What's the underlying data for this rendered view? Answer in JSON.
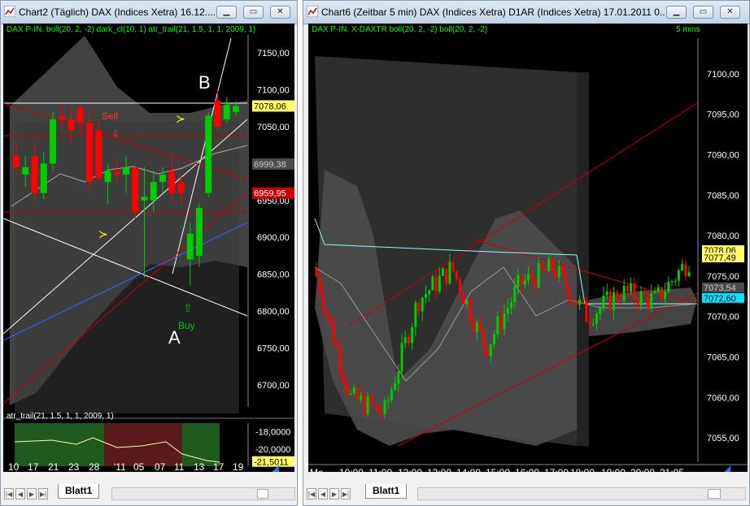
{
  "left": {
    "title": "Chart2 (Täglich)  DAX (Indices Xetra) 16.12....",
    "indicator_header": "DAX P-IN. boll(20, 2, -2) dark_cl(10, 1) atr_trail(21, 1.5, 1, 1, 2009, 1)",
    "sub_header": "atr_trail(21, 1.5, 1, 1, 2009, 1)",
    "sheet_tab": "Blatt1",
    "price_labels": [
      "7150,00",
      "7100,00",
      "7050,00",
      "7000,00",
      "6950,00",
      "6900,00",
      "6850,00",
      "6800,00",
      "6750,00",
      "6700,00"
    ],
    "price_tags": [
      {
        "text": "7078,06",
        "bg": "#ffff66",
        "fg": "#000000"
      },
      {
        "text": "6999,38",
        "bg": "#4a4a4a",
        "fg": "#cccccc"
      },
      {
        "text": "6959,95",
        "bg": "#cc0000",
        "fg": "#ffffff"
      }
    ],
    "sub_labels": [
      "-18,0000",
      "-20,0000"
    ],
    "sub_tag": "-21,5011",
    "x_labels": [
      "10",
      "17",
      "21",
      "23",
      "28",
      "'11",
      "05",
      "07",
      "11",
      "13",
      "17",
      "19"
    ],
    "annotations": {
      "sell": "Sell",
      "buy": "Buy",
      "point_a": "A",
      "point_b": "B"
    }
  },
  "right": {
    "title": "Chart6 (Zeitbar 5 min)  DAX (Indices Xetra) D1AR (Indices Xetra) 17.01.2011 0...",
    "indicator_header": "DAX P-IN. X-DAXTR boll(20, 2, -2) boll(20, 2, -2)",
    "interval": "5 mins",
    "sheet_tab": "Blatt1",
    "price_labels": [
      "7100,00",
      "7095,00",
      "7090,00",
      "7085,00",
      "7080,00",
      "7075,00",
      "7070,00",
      "7065,00",
      "7060,00",
      "7055,00"
    ],
    "price_tags": [
      {
        "text": "7078,06",
        "bg": "#ffff66",
        "fg": "#000000"
      },
      {
        "text": "7077,49",
        "bg": "#ffff66",
        "fg": "#000000"
      },
      {
        "text": "7073,54",
        "bg": "#4a4a4a",
        "fg": "#cccccc"
      },
      {
        "text": "7072,60",
        "bg": "#00e5ff",
        "fg": "#000000"
      }
    ],
    "x_labels": [
      "Mo",
      "10:00",
      "11:00",
      "12:00",
      "13:00",
      "14:00",
      "15:00",
      "16:00",
      "17:00",
      "18:00",
      "19:00",
      "20:00",
      "21:05"
    ]
  },
  "colors": {
    "bull": "#00cc00",
    "bear": "#ff0000",
    "band_fill": "#4d4d4d",
    "background": "#000000",
    "axis_text": "#ffffff",
    "header_text": "#00ff00"
  },
  "chart_data": [
    {
      "type": "candlestick",
      "title": "DAX (Indices Xetra) daily",
      "ylim": [
        6670,
        7170
      ],
      "y_ticks": [
        7150,
        7100,
        7050,
        7000,
        6950,
        6900,
        6850,
        6800,
        6750,
        6700
      ],
      "candles": [
        {
          "o": 7010,
          "h": 7030,
          "l": 6985,
          "c": 6995
        },
        {
          "o": 6985,
          "h": 7010,
          "l": 6968,
          "c": 6995
        },
        {
          "o": 7010,
          "h": 7030,
          "l": 6950,
          "c": 6960
        },
        {
          "o": 6960,
          "h": 7015,
          "l": 6952,
          "c": 7000
        },
        {
          "o": 7000,
          "h": 7070,
          "l": 6990,
          "c": 7060
        },
        {
          "o": 7065,
          "h": 7080,
          "l": 7045,
          "c": 7060
        },
        {
          "o": 7060,
          "h": 7075,
          "l": 7030,
          "c": 7045
        },
        {
          "o": 7075,
          "h": 7080,
          "l": 7040,
          "c": 7055
        },
        {
          "o": 7055,
          "h": 7070,
          "l": 6960,
          "c": 6975
        },
        {
          "o": 7045,
          "h": 7060,
          "l": 6975,
          "c": 6980
        },
        {
          "o": 6975,
          "h": 7000,
          "l": 6945,
          "c": 6990
        },
        {
          "o": 6990,
          "h": 7005,
          "l": 6975,
          "c": 6985
        },
        {
          "o": 6985,
          "h": 7010,
          "l": 6960,
          "c": 6995
        },
        {
          "o": 6995,
          "h": 7000,
          "l": 6925,
          "c": 6935
        },
        {
          "o": 6950,
          "h": 6995,
          "l": 6845,
          "c": 6955
        },
        {
          "o": 6950,
          "h": 6990,
          "l": 6935,
          "c": 6975
        },
        {
          "o": 6975,
          "h": 6995,
          "l": 6960,
          "c": 6985
        },
        {
          "o": 6990,
          "h": 7010,
          "l": 6950,
          "c": 6960
        },
        {
          "o": 6975,
          "h": 6985,
          "l": 6945,
          "c": 6960
        },
        {
          "o": 6870,
          "h": 6920,
          "l": 6835,
          "c": 6905
        },
        {
          "o": 6875,
          "h": 6945,
          "l": 6860,
          "c": 6940
        },
        {
          "o": 6960,
          "h": 7070,
          "l": 6955,
          "c": 7065
        },
        {
          "o": 7085,
          "h": 7100,
          "l": 7045,
          "c": 7050
        },
        {
          "o": 7060,
          "h": 7090,
          "l": 7055,
          "c": 7080
        },
        {
          "o": 7070,
          "h": 7085,
          "l": 7065,
          "c": 7078
        }
      ],
      "sub_panel": {
        "name": "atr_trail(21, 1.5, 1, 1, 2009, 1)",
        "ylim": [
          -22,
          -17
        ],
        "last": -21.5011
      }
    },
    {
      "type": "line",
      "title": "DAX 5 min",
      "ylim": [
        7052,
        7104
      ],
      "y_ticks": [
        7100,
        7095,
        7090,
        7085,
        7080,
        7075,
        7070,
        7065,
        7060,
        7055
      ],
      "x": [
        "10:00",
        "11:00",
        "12:00",
        "13:00",
        "14:00",
        "15:00",
        "16:00",
        "17:00",
        "18:00",
        "19:00",
        "20:00",
        "21:05"
      ],
      "series": [
        {
          "values": [
            7075,
            7060,
            7058,
            7072,
            7076,
            7066,
            7074,
            7076,
            7070,
            7073,
            7072,
            7077
          ]
        }
      ],
      "last": 7077.49
    }
  ]
}
